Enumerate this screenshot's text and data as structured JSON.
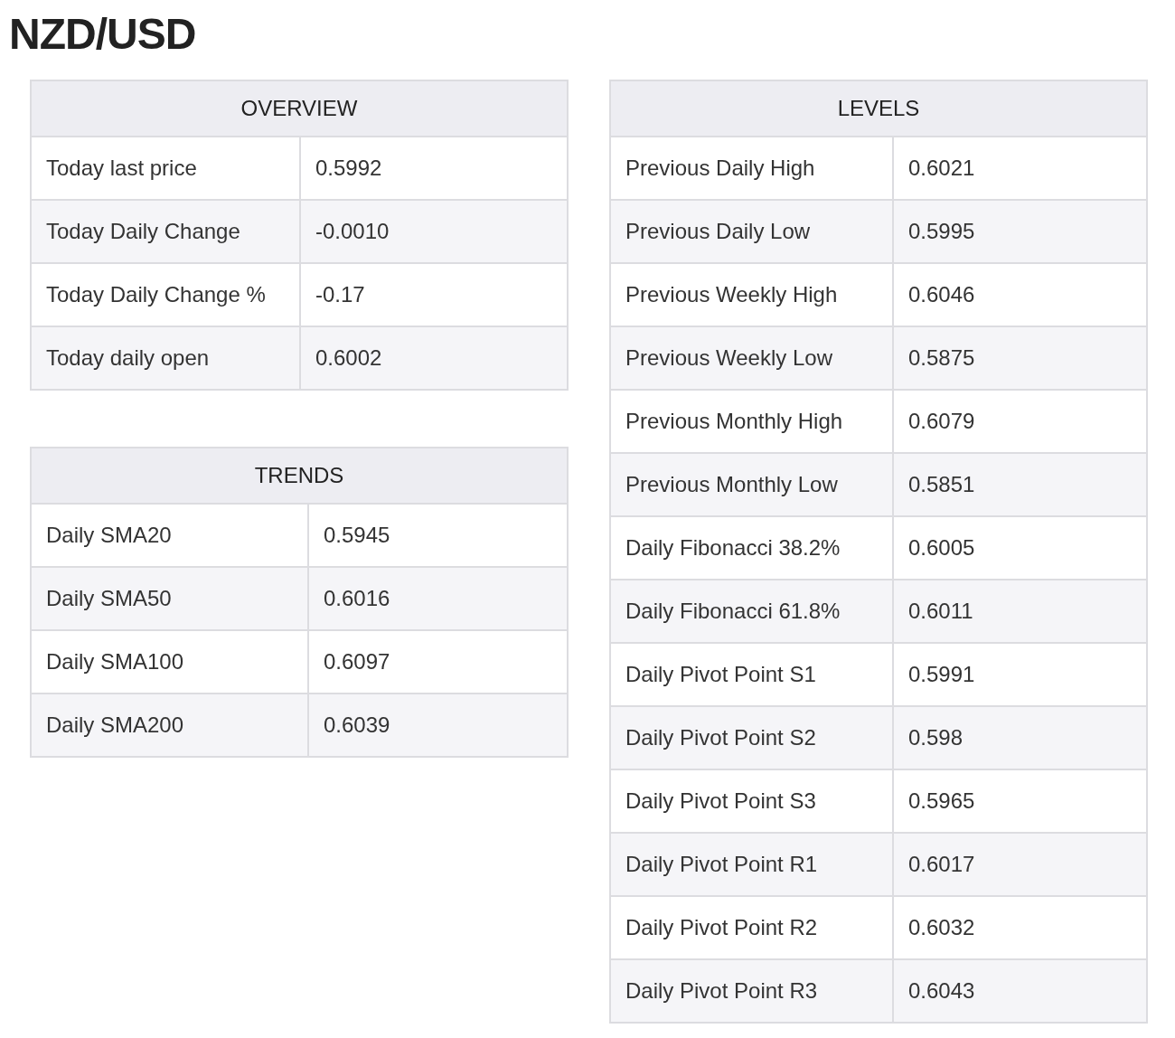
{
  "title": "NZD/USD",
  "overview": {
    "heading": "OVERVIEW",
    "rows": [
      {
        "label": "Today last price",
        "value": "0.5992"
      },
      {
        "label": "Today Daily Change",
        "value": "-0.0010"
      },
      {
        "label": "Today Daily Change %",
        "value": "-0.17"
      },
      {
        "label": "Today daily open",
        "value": "0.6002"
      }
    ]
  },
  "trends": {
    "heading": "TRENDS",
    "rows": [
      {
        "label": "Daily SMA20",
        "value": "0.5945"
      },
      {
        "label": "Daily SMA50",
        "value": "0.6016"
      },
      {
        "label": "Daily SMA100",
        "value": "0.6097"
      },
      {
        "label": "Daily SMA200",
        "value": "0.6039"
      }
    ]
  },
  "levels": {
    "heading": "LEVELS",
    "rows": [
      {
        "label": "Previous Daily High",
        "value": "0.6021"
      },
      {
        "label": "Previous Daily Low",
        "value": "0.5995"
      },
      {
        "label": "Previous Weekly High",
        "value": "0.6046"
      },
      {
        "label": "Previous Weekly Low",
        "value": "0.5875"
      },
      {
        "label": "Previous Monthly High",
        "value": "0.6079"
      },
      {
        "label": "Previous Monthly Low",
        "value": "0.5851"
      },
      {
        "label": "Daily Fibonacci 38.2%",
        "value": "0.6005"
      },
      {
        "label": "Daily Fibonacci 61.8%",
        "value": "0.6011"
      },
      {
        "label": "Daily Pivot Point S1",
        "value": "0.5991"
      },
      {
        "label": "Daily Pivot Point S2",
        "value": "0.598"
      },
      {
        "label": "Daily Pivot Point S3",
        "value": "0.5965"
      },
      {
        "label": "Daily Pivot Point R1",
        "value": "0.6017"
      },
      {
        "label": "Daily Pivot Point R2",
        "value": "0.6032"
      },
      {
        "label": "Daily Pivot Point R3",
        "value": "0.6043"
      }
    ]
  }
}
